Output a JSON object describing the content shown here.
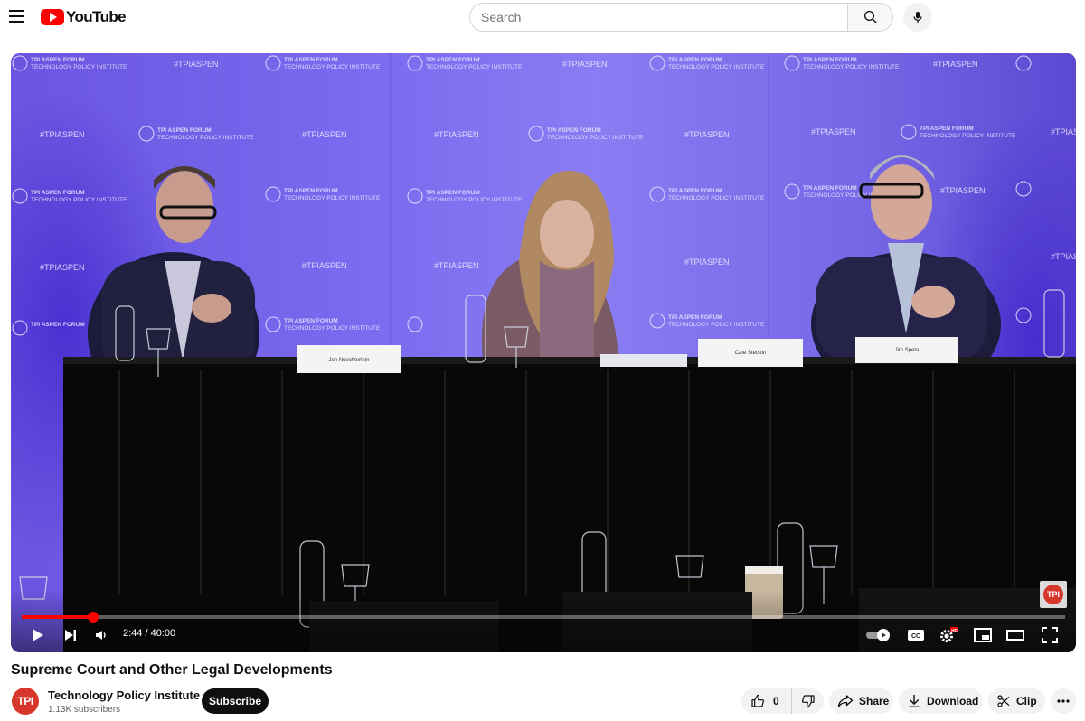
{
  "header": {
    "logo_text": "YouTube",
    "search_placeholder": "Search"
  },
  "player": {
    "backdrop_text": "#TPIASPEN",
    "backdrop_brand_line1": "TPI ASPEN FORUM",
    "backdrop_brand_line2": "TECHNOLOGY POLICY INSTITUTE",
    "backdrop_logo": "TPI",
    "nameplates": [
      "Jon Nuechterlein",
      "Cate Stetson",
      "Jim Speta"
    ],
    "watermark": "TPI",
    "current_time": "2:44",
    "duration": "40:00",
    "time_display": "2:44 / 40:00",
    "progress": 0.0683,
    "settings_badge": "HD"
  },
  "video": {
    "title": "Supreme Court and Other Legal Developments"
  },
  "channel": {
    "avatar_text": "TPI",
    "name": "Technology Policy Institute",
    "subscribers": "1.13K subscribers",
    "subscribe_label": "Subscribe"
  },
  "actions": {
    "like_count": "0",
    "share_label": "Share",
    "download_label": "Download",
    "clip_label": "Clip"
  },
  "colors": {
    "accent": "#ff0000",
    "backdrop": "#5a46c8",
    "avatar": "#d6372a"
  }
}
